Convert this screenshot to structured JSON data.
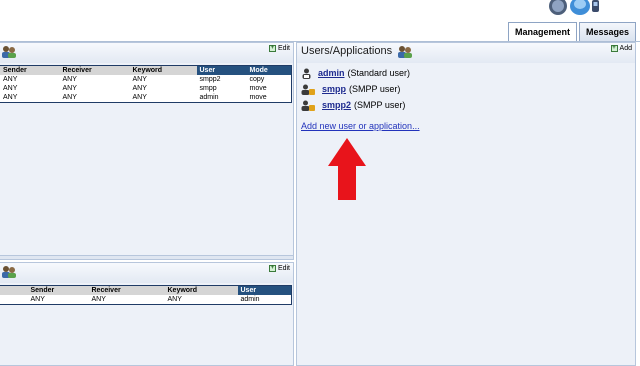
{
  "tabs": [
    {
      "label": "Management",
      "active": true
    },
    {
      "label": "Messages",
      "active": false
    }
  ],
  "routing_panel": {
    "edit_label": "Edit",
    "columns": [
      "Sender",
      "Receiver",
      "Keyword",
      "User",
      "Mode"
    ],
    "rows": [
      [
        "ANY",
        "ANY",
        "ANY",
        "smpp2",
        "copy"
      ],
      [
        "ANY",
        "ANY",
        "ANY",
        "smpp",
        "move"
      ],
      [
        "ANY",
        "ANY",
        "ANY",
        "admin",
        "move"
      ]
    ]
  },
  "second_panel": {
    "edit_label": "Edit",
    "columns": [
      "",
      "Sender",
      "Receiver",
      "Keyword",
      "User"
    ],
    "rows": [
      [
        "",
        "ANY",
        "ANY",
        "ANY",
        "admin"
      ]
    ]
  },
  "users_panel": {
    "title": "Users/Applications",
    "add_label": "Add",
    "users": [
      {
        "name": "admin",
        "type": "(Standard user)",
        "icon": "user-icon"
      },
      {
        "name": "smpp",
        "type": "(SMPP user)",
        "icon": "smpp-user-icon"
      },
      {
        "name": "smpp2",
        "type": "(SMPP user)",
        "icon": "smpp-user-icon"
      }
    ],
    "add_new_link": "Add new user or application..."
  },
  "colors": {
    "panel_bg": "#edf1f8",
    "header_dark": "#25517f",
    "link": "#1d2a8f",
    "arrow": "#e8141b"
  }
}
